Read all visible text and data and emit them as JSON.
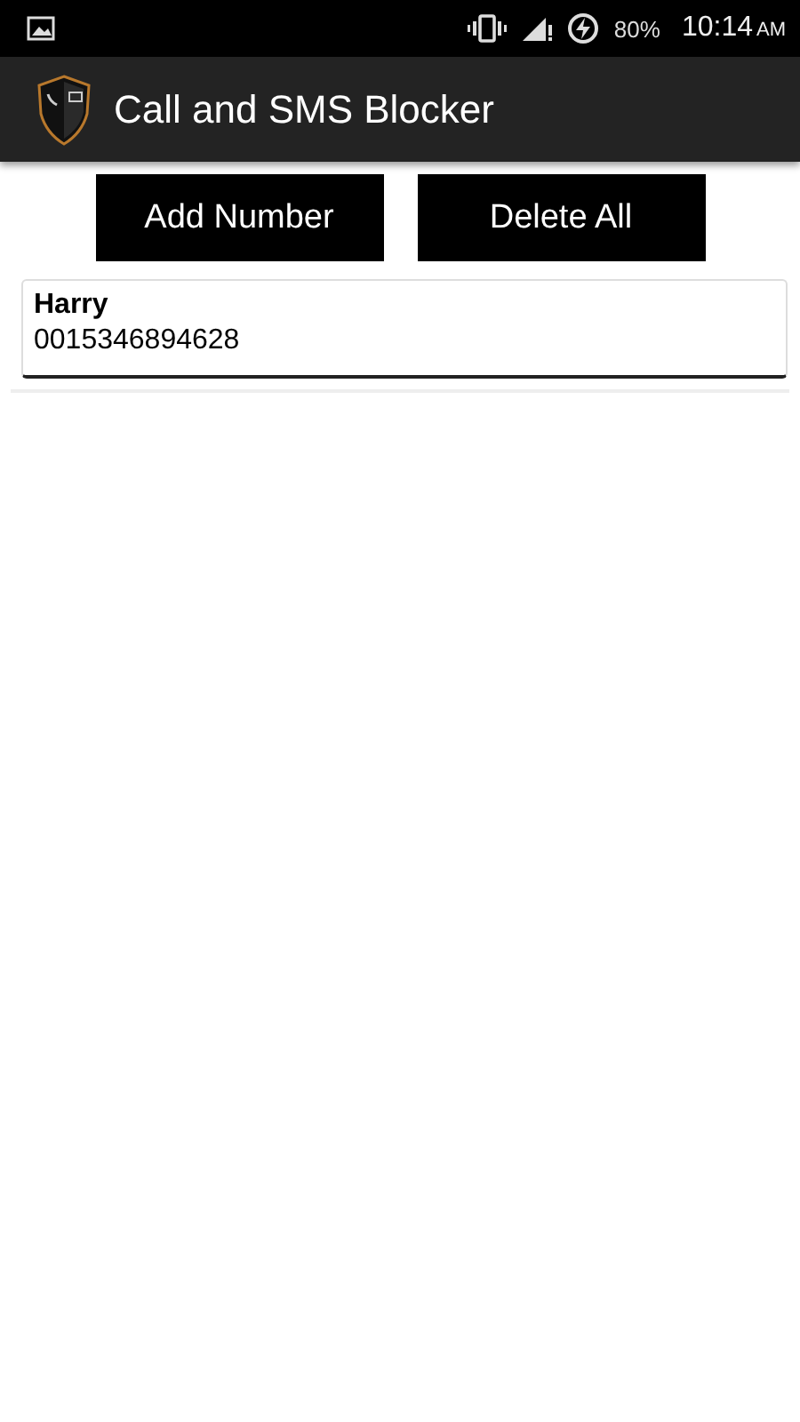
{
  "status_bar": {
    "battery": "80%",
    "time": "10:14",
    "meridiem": "AM"
  },
  "app_bar": {
    "title": "Call and SMS Blocker"
  },
  "buttons": [
    "Add Number",
    "Delete All"
  ],
  "contacts": [
    {
      "name": "Harry",
      "number": "0015346894628"
    }
  ]
}
